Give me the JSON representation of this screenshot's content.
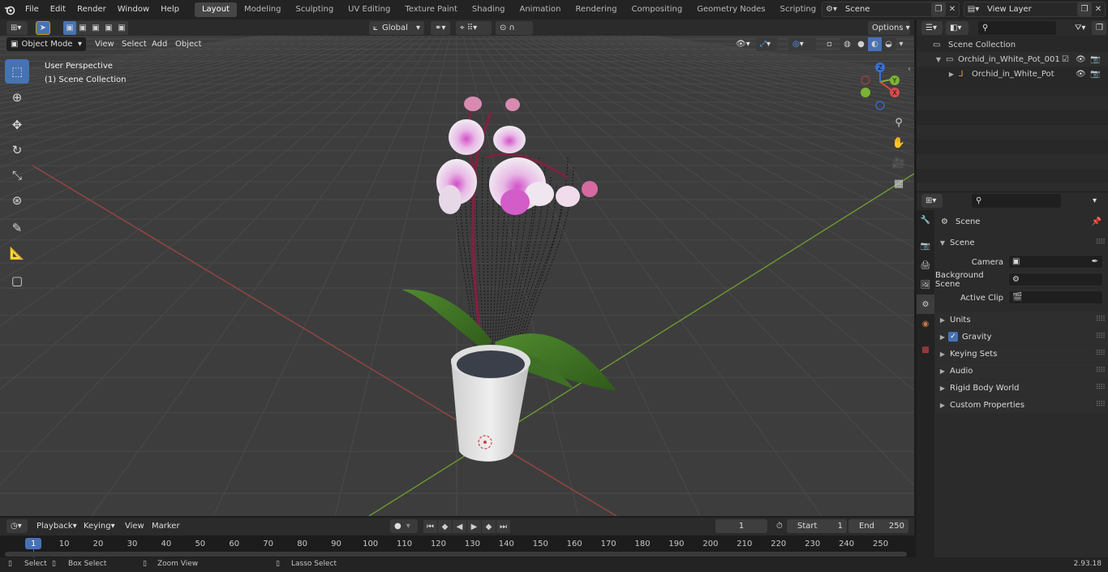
{
  "app": {
    "menus": [
      "File",
      "Edit",
      "Render",
      "Window",
      "Help"
    ],
    "workspace_tabs": [
      "Layout",
      "Modeling",
      "Sculpting",
      "UV Editing",
      "Texture Paint",
      "Shading",
      "Animation",
      "Rendering",
      "Compositing",
      "Geometry Nodes",
      "Scripting"
    ],
    "active_tab": "Layout",
    "scene_name": "Scene",
    "view_layer_name": "View Layer",
    "version": "2.93.18"
  },
  "viewport": {
    "mode": "Object Mode",
    "header_menus": [
      "View",
      "Select",
      "Add",
      "Object"
    ],
    "transform_orientation": "Global",
    "options_label": "Options",
    "perspective_label": "User Perspective",
    "collection_label": "(1) Scene Collection",
    "gizmo_axes": {
      "x": "X",
      "y": "Y",
      "z": "Z"
    },
    "colors": {
      "grid_bg": "#3d3d3d",
      "x_axis": "#a8443f",
      "y_axis": "#6c9c2e",
      "accent": "#4772b3"
    }
  },
  "toolbar": {
    "tools": [
      "select-box",
      "cursor",
      "move",
      "rotate",
      "scale",
      "transform",
      "annotate",
      "measure",
      "add-cube"
    ]
  },
  "outliner": {
    "root": "Scene Collection",
    "items": [
      {
        "label": "Orchid_in_White_Pot_001",
        "depth": 1
      },
      {
        "label": "Orchid_in_White_Pot",
        "depth": 2
      }
    ]
  },
  "properties": {
    "context": "Scene",
    "panel_title": "Scene",
    "fields": [
      {
        "label": "Camera",
        "value": ""
      },
      {
        "label": "Background Scene",
        "value": ""
      },
      {
        "label": "Active Clip",
        "value": ""
      }
    ],
    "sections": [
      "Units",
      "Gravity",
      "Keying Sets",
      "Audio",
      "Rigid Body World",
      "Custom Properties"
    ]
  },
  "timeline": {
    "menus": [
      "Playback",
      "Keying",
      "View",
      "Marker"
    ],
    "current_frame": "1",
    "start_label": "Start",
    "start": "1",
    "end_label": "End",
    "end": "250",
    "ruler": [
      "1",
      "10",
      "20",
      "30",
      "40",
      "50",
      "60",
      "70",
      "80",
      "90",
      "100",
      "110",
      "120",
      "130",
      "140",
      "150",
      "160",
      "170",
      "180",
      "190",
      "200",
      "210",
      "220",
      "230",
      "240",
      "250"
    ]
  },
  "status": {
    "items": [
      "Select",
      "Box Select",
      "Zoom View",
      "Lasso Select"
    ]
  }
}
